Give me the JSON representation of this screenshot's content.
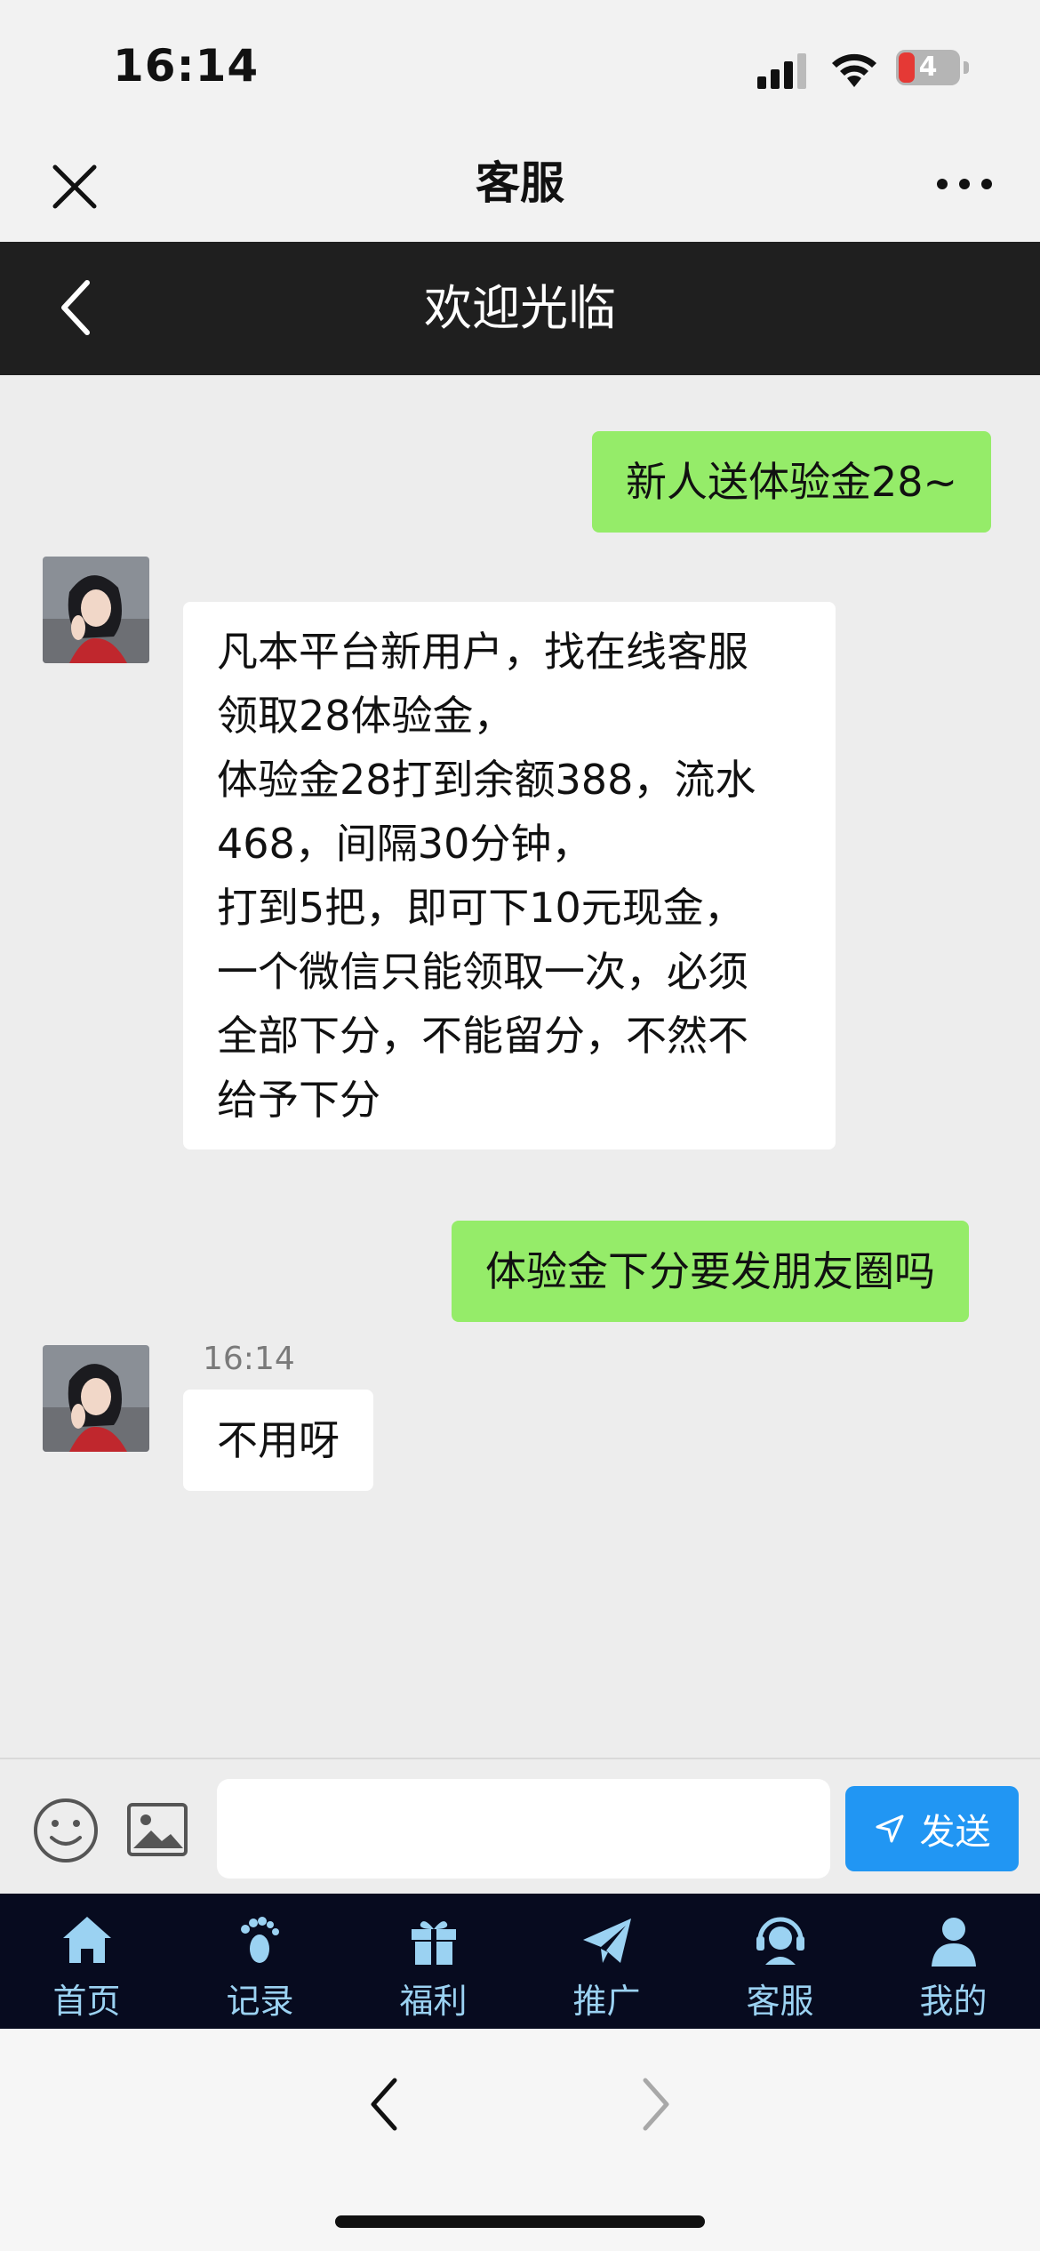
{
  "status_bar": {
    "time": "16:14",
    "battery": "4"
  },
  "wechat_nav": {
    "title": "客服"
  },
  "page_header": {
    "title": "欢迎光临"
  },
  "messages": [
    {
      "from": "me",
      "text": "新人送体验金28~"
    },
    {
      "from": "agent",
      "lines": [
        "凡本平台新用户，找在线客服",
        "领取28体验金，",
        "体验金28打到余额388，流水",
        "468，间隔30分钟，",
        "打到5把，即可下10元现金，",
        "一个微信只能领取一次，必须",
        "全部下分，不能留分，不然不",
        "给予下分"
      ]
    },
    {
      "from": "me",
      "text": "体验金下分要发朋友圈吗"
    },
    {
      "from": "agent",
      "time": "16:14",
      "text": "不用呀"
    }
  ],
  "input_bar": {
    "placeholder": "",
    "send_label": "发送"
  },
  "tabbar": {
    "items": [
      {
        "label": "首页",
        "icon": "home-icon"
      },
      {
        "label": "记录",
        "icon": "footprint-icon"
      },
      {
        "label": "福利",
        "icon": "gift-icon"
      },
      {
        "label": "推广",
        "icon": "paper-plane-icon"
      },
      {
        "label": "客服",
        "icon": "headset-icon"
      },
      {
        "label": "我的",
        "icon": "user-icon"
      }
    ]
  },
  "colors": {
    "my_bubble": "#95ec69",
    "send_button": "#2196f3",
    "tabbar_bg": "#070b1f",
    "tab_accent": "#9bd2f2"
  }
}
